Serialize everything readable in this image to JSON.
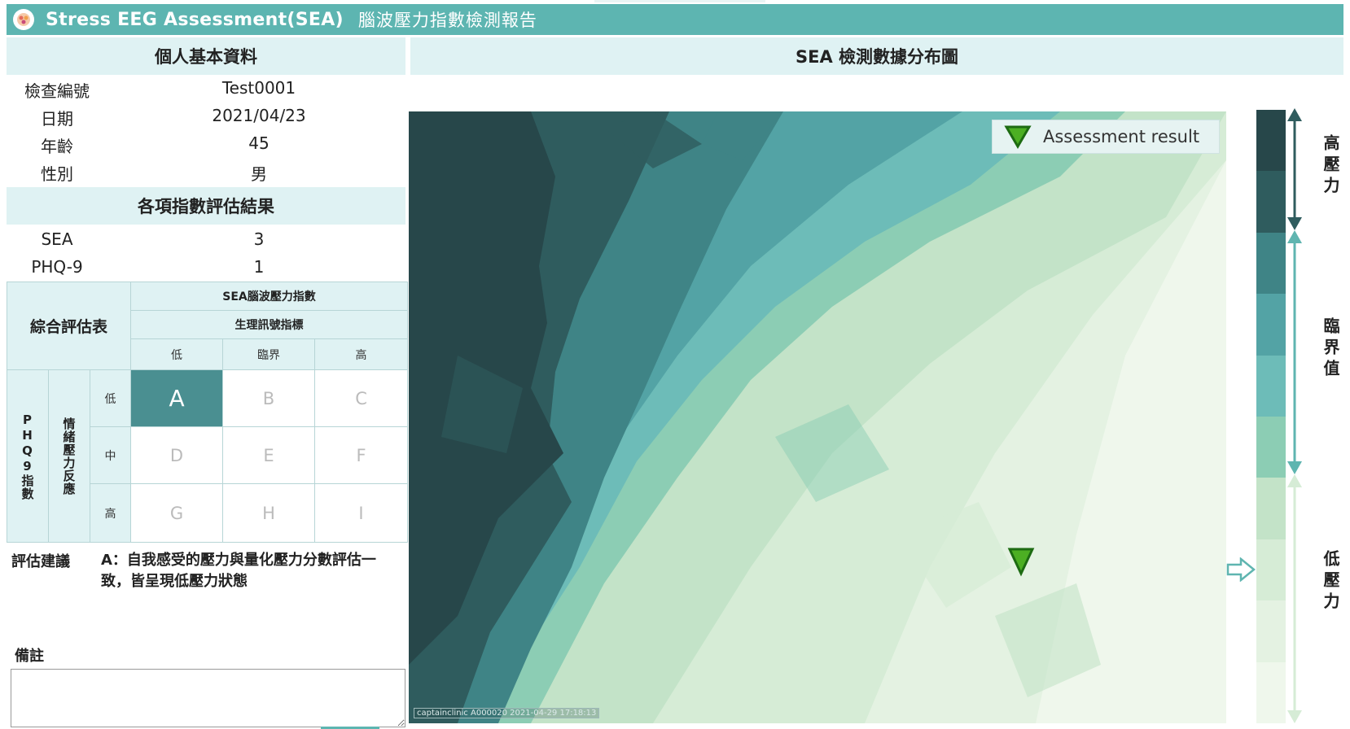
{
  "header": {
    "title_en": "Stress EEG Assessment(SEA)",
    "title_zh": "腦波壓力指數檢測報告",
    "bg_color": "#5db5b1",
    "logo_icon": "brain-logo-icon"
  },
  "personal": {
    "heading": "個人基本資料",
    "rows": [
      {
        "label": "檢查編號",
        "value": "Test0001"
      },
      {
        "label": "日期",
        "value": "2021/04/23"
      },
      {
        "label": "年齡",
        "value": "45"
      },
      {
        "label": "性別",
        "value": "男"
      }
    ]
  },
  "indices": {
    "heading": "各項指數評估結果",
    "rows": [
      {
        "label": "SEA",
        "value": "3"
      },
      {
        "label": "PHQ-9",
        "value": "1"
      }
    ]
  },
  "matrix": {
    "title": "綜合評估表",
    "col_header_1": "SEA腦波壓力指數",
    "col_header_2": "生理訊號指標",
    "col_levels": [
      "低",
      "臨界",
      "高"
    ],
    "row_group_1": "PHQ9指數",
    "row_group_2": "情緒壓力反應",
    "row_levels": [
      "低",
      "中",
      "高"
    ],
    "cells": [
      [
        "A",
        "B",
        "C"
      ],
      [
        "D",
        "E",
        "F"
      ],
      [
        "G",
        "H",
        "I"
      ]
    ],
    "active_cell": "A",
    "active_color": "#4a8f91"
  },
  "advice": {
    "label": "評估建議",
    "text": "A：自我感受的壓力與量化壓力分數評估一致，皆呈現低壓力狀態"
  },
  "notes": {
    "label": "備註",
    "value": ""
  },
  "chart": {
    "heading": "SEA 檢測數據分布圖",
    "legend_label": "Assessment result",
    "marker_icon": "green-triangle-marker-icon",
    "watermark": "captainclinic A000020 2021-04-29 17:18:13"
  },
  "scale": {
    "high_label": "高壓力",
    "mid_label": "臨界值",
    "low_label": "低壓力",
    "current_icon": "arrow-right-icon",
    "colors": [
      "#27474a",
      "#2f5c5e",
      "#3f8486",
      "#53a3a5",
      "#6dbcb8",
      "#8ccdb4",
      "#c3e3c8",
      "#d6ecd6",
      "#e4f2e2",
      "#eff7ec"
    ]
  }
}
